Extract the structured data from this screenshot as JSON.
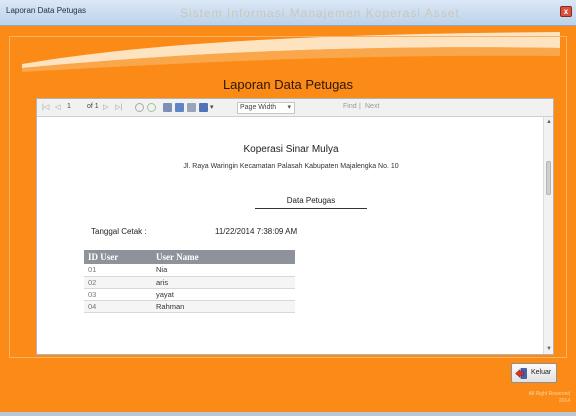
{
  "window": {
    "title": "Laporan Data Petugas",
    "ghost_title": "Sistem Informasi Manajemen Koperasi Asset",
    "close_symbol": "x"
  },
  "report_title": "Laporan Data Petugas",
  "toolbar": {
    "first_page": "|◁",
    "prev_page": "◁",
    "page_number": "1",
    "page_of": "of 1",
    "next_page": "▷",
    "last_page": "▷|",
    "zoom": "Page Width",
    "find": "Find",
    "next": "Next",
    "icons": [
      "stop-icon",
      "refresh-icon",
      "print-icon",
      "print-layout-icon",
      "page-setup-icon",
      "export-icon"
    ]
  },
  "report": {
    "company": "Koperasi Sinar Mulya",
    "address": "Jl. Raya Waringin Kecamatan Palasah Kabupaten Majalengka No. 10",
    "section_title": "Data Petugas",
    "print_label": "Tanggal  Cetak :",
    "print_value": "11/22/2014 7:38:09 AM",
    "columns": [
      "ID User",
      "User Name"
    ],
    "rows": [
      [
        "01",
        "Nia"
      ],
      [
        "02",
        "aris"
      ],
      [
        "03",
        "yayat"
      ],
      [
        "04",
        "Rahman"
      ]
    ]
  },
  "exit_button": {
    "label": "Keluar"
  },
  "footer": {
    "line1": "All Right Reserved",
    "line2": "2014"
  },
  "colors": {
    "background": "#fb8a16",
    "header": "#8e929a",
    "accent": "#d9523e"
  }
}
